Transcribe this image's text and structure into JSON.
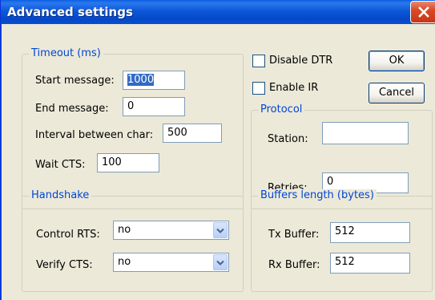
{
  "window": {
    "title": "Advanced settings"
  },
  "timeout": {
    "legend": "Timeout (ms)",
    "start_label": "Start message:",
    "start_value": "1000",
    "end_label": "End message:",
    "end_value": "0",
    "interval_label": "Interval between char:",
    "interval_value": "500",
    "wait_label": "Wait CTS:",
    "wait_value": "100"
  },
  "options": {
    "disable_dtr_label": "Disable DTR",
    "disable_dtr_checked": false,
    "enable_ir_label": "Enable IR",
    "enable_ir_checked": false
  },
  "buttons": {
    "ok_label": "OK",
    "cancel_label": "Cancel"
  },
  "protocol": {
    "legend": "Protocol",
    "station_label": "Station:",
    "station_value": "",
    "retries_label": "Retries:",
    "retries_value": "0"
  },
  "handshake": {
    "legend": "Handshake",
    "control_rts_label": "Control RTS:",
    "control_rts_value": "no",
    "verify_cts_label": "Verify CTS:",
    "verify_cts_value": "no"
  },
  "buffers": {
    "legend": "Buffers length (bytes)",
    "tx_label": "Tx Buffer:",
    "tx_value": "512",
    "rx_label": "Rx Buffer:",
    "rx_value": "512"
  },
  "icons": {
    "close": "close-icon",
    "dropdown": "chevron-down-icon"
  },
  "colors": {
    "titlebar": "#0d58d8",
    "dialog_bg": "#ece9d8",
    "groupbox_title": "#0046d5",
    "close_button": "#d94a26"
  }
}
